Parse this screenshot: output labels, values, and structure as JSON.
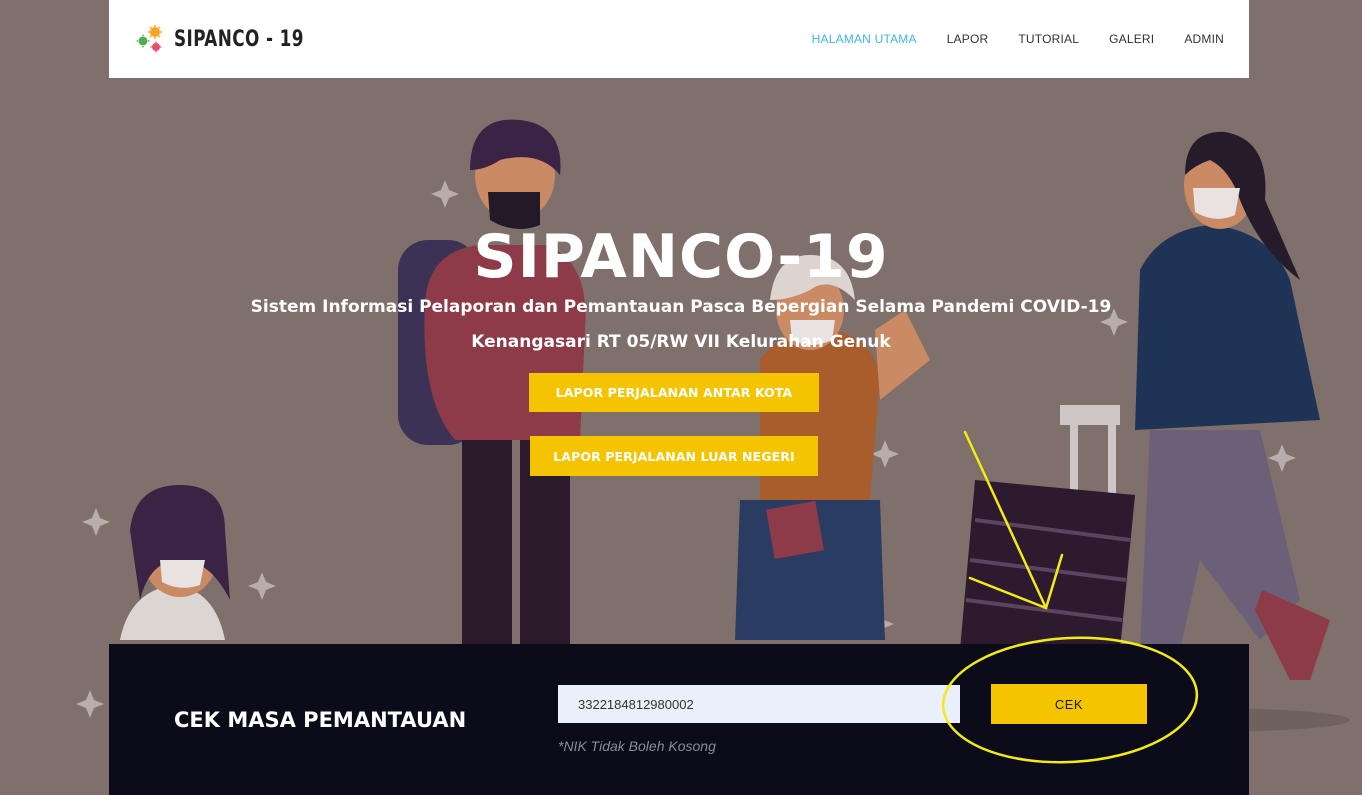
{
  "colors": {
    "accent_yellow": "#f5c400",
    "nav_active": "#3fb6e0",
    "hero_bg": "#7f706b",
    "panel_bg": "#0b0b1a",
    "input_bg": "#e9effb",
    "annotation": "#f2ec16"
  },
  "navbar": {
    "brand": "SIPANCO - 19",
    "brand_icon": "virus-cluster-logo",
    "items": [
      {
        "label": "HALAMAN UTAMA",
        "active": true
      },
      {
        "label": "LAPOR",
        "active": false
      },
      {
        "label": "TUTORIAL",
        "active": false
      },
      {
        "label": "GALERI",
        "active": false
      },
      {
        "label": "ADMIN",
        "active": false
      }
    ]
  },
  "hero": {
    "title": "SIPANCO-19",
    "subtitle": "Sistem Informasi Pelaporan dan Pemantauan Pasca Bepergian Selama Pandemi COVID-19",
    "location": "Kenangasari RT 05/RW VII Kelurahan Genuk",
    "buttons": {
      "antar_kota": "LAPOR PERJALANAN ANTAR KOTA",
      "luar_negeri": "LAPOR PERJALANAN LUAR NEGERI"
    }
  },
  "check": {
    "heading": "CEK MASA PEMANTAUAN",
    "nik_value": "3322184812980002",
    "hint": "*NIK Tidak Boleh Kosong",
    "button_label": "CEK"
  }
}
